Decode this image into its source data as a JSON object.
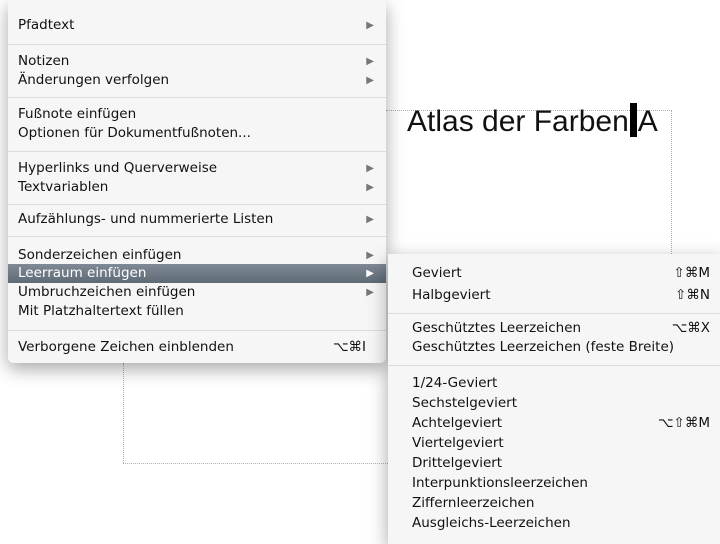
{
  "document": {
    "text": "Atlas der Farben",
    "trailing_char": "A"
  },
  "context_menu": {
    "items": [
      {
        "label": "Pfadtext",
        "submenu": true
      },
      {
        "label": "Notizen",
        "submenu": true
      },
      {
        "label": "Änderungen verfolgen",
        "submenu": true
      },
      {
        "label": "Fußnote einfügen"
      },
      {
        "label": "Optionen für Dokumentfußnoten..."
      },
      {
        "label": "Hyperlinks und Querverweise",
        "submenu": true
      },
      {
        "label": "Textvariablen",
        "submenu": true
      },
      {
        "label": "Aufzählungs- und nummerierte Listen",
        "submenu": true
      },
      {
        "label": "Sonderzeichen einfügen",
        "submenu": true
      },
      {
        "label": "Leerraum einfügen",
        "submenu": true,
        "selected": true
      },
      {
        "label": "Umbruchzeichen einfügen",
        "submenu": true
      },
      {
        "label": "Mit Platzhaltertext füllen"
      },
      {
        "label": "Verborgene Zeichen einblenden",
        "shortcut": "⌥⌘I"
      }
    ],
    "submenu_arrow": "▶"
  },
  "submenu": {
    "items": [
      {
        "label": "Geviert",
        "shortcut": "⇧⌘M"
      },
      {
        "label": "Halbgeviert",
        "shortcut": "⇧⌘N"
      },
      {
        "label": "Geschütztes Leerzeichen",
        "shortcut": "⌥⌘X"
      },
      {
        "label": "Geschütztes Leerzeichen (feste Breite)"
      },
      {
        "label": "1/24-Geviert"
      },
      {
        "label": "Sechstelgeviert"
      },
      {
        "label": "Achtelgeviert",
        "shortcut": "⌥⇧⌘M"
      },
      {
        "label": "Viertelgeviert"
      },
      {
        "label": "Drittelgeviert"
      },
      {
        "label": "Interpunktionsleerzeichen"
      },
      {
        "label": "Ziffernleerzeichen"
      },
      {
        "label": "Ausgleichs-Leerzeichen"
      }
    ]
  },
  "colors": {
    "highlight": "#6b7683",
    "guides": "#8fb6e2"
  }
}
